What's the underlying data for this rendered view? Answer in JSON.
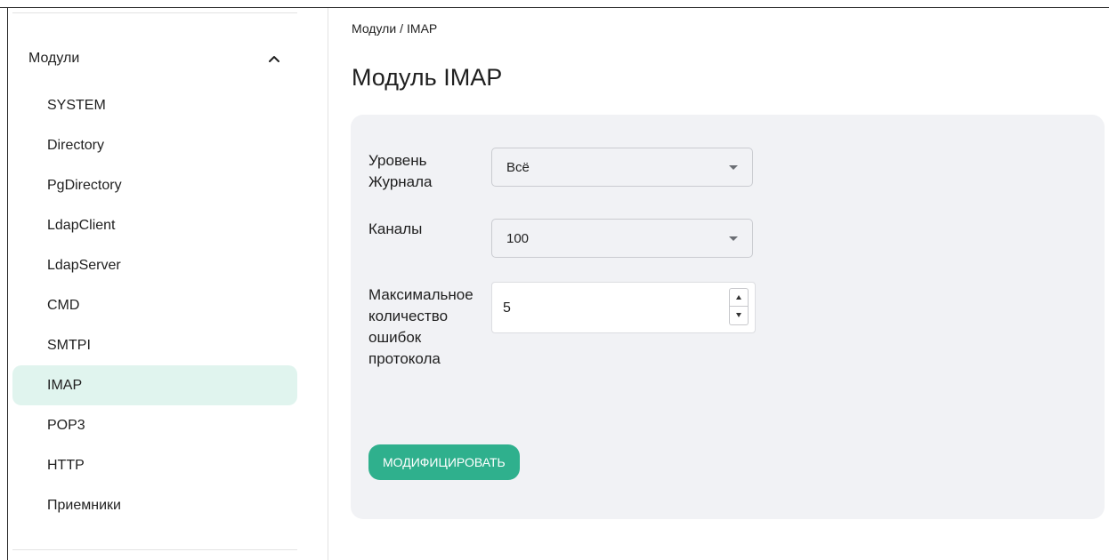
{
  "breadcrumb": {
    "parent": "Модули",
    "separator": "/",
    "current": "IMAP"
  },
  "page": {
    "title": "Модуль IMAP"
  },
  "sidebar": {
    "group_label": "Модули",
    "expanded": true,
    "items": [
      {
        "label": "SYSTEM",
        "active": false
      },
      {
        "label": "Directory",
        "active": false
      },
      {
        "label": "PgDirectory",
        "active": false
      },
      {
        "label": "LdapClient",
        "active": false
      },
      {
        "label": "LdapServer",
        "active": false
      },
      {
        "label": "CMD",
        "active": false
      },
      {
        "label": "SMTPI",
        "active": false
      },
      {
        "label": "IMAP",
        "active": true
      },
      {
        "label": "POP3",
        "active": false
      },
      {
        "label": "HTTP",
        "active": false
      },
      {
        "label": "Приемники",
        "active": false
      }
    ]
  },
  "form": {
    "log_level": {
      "label_line1": "Уровень",
      "label_line2": "Журнала",
      "value": "Всё"
    },
    "channels": {
      "label": "Каналы",
      "value": "100"
    },
    "max_errors": {
      "label_line1": "Максимальное",
      "label_line2": "количество",
      "label_line3": "ошибок",
      "label_line4": "протокола",
      "value": "5"
    },
    "submit_label": "МОДИФИЦИРОВАТЬ"
  },
  "colors": {
    "accent": "#2fb08d",
    "active_item_bg": "#e0f4ee",
    "panel_bg": "#f1f2f5"
  }
}
